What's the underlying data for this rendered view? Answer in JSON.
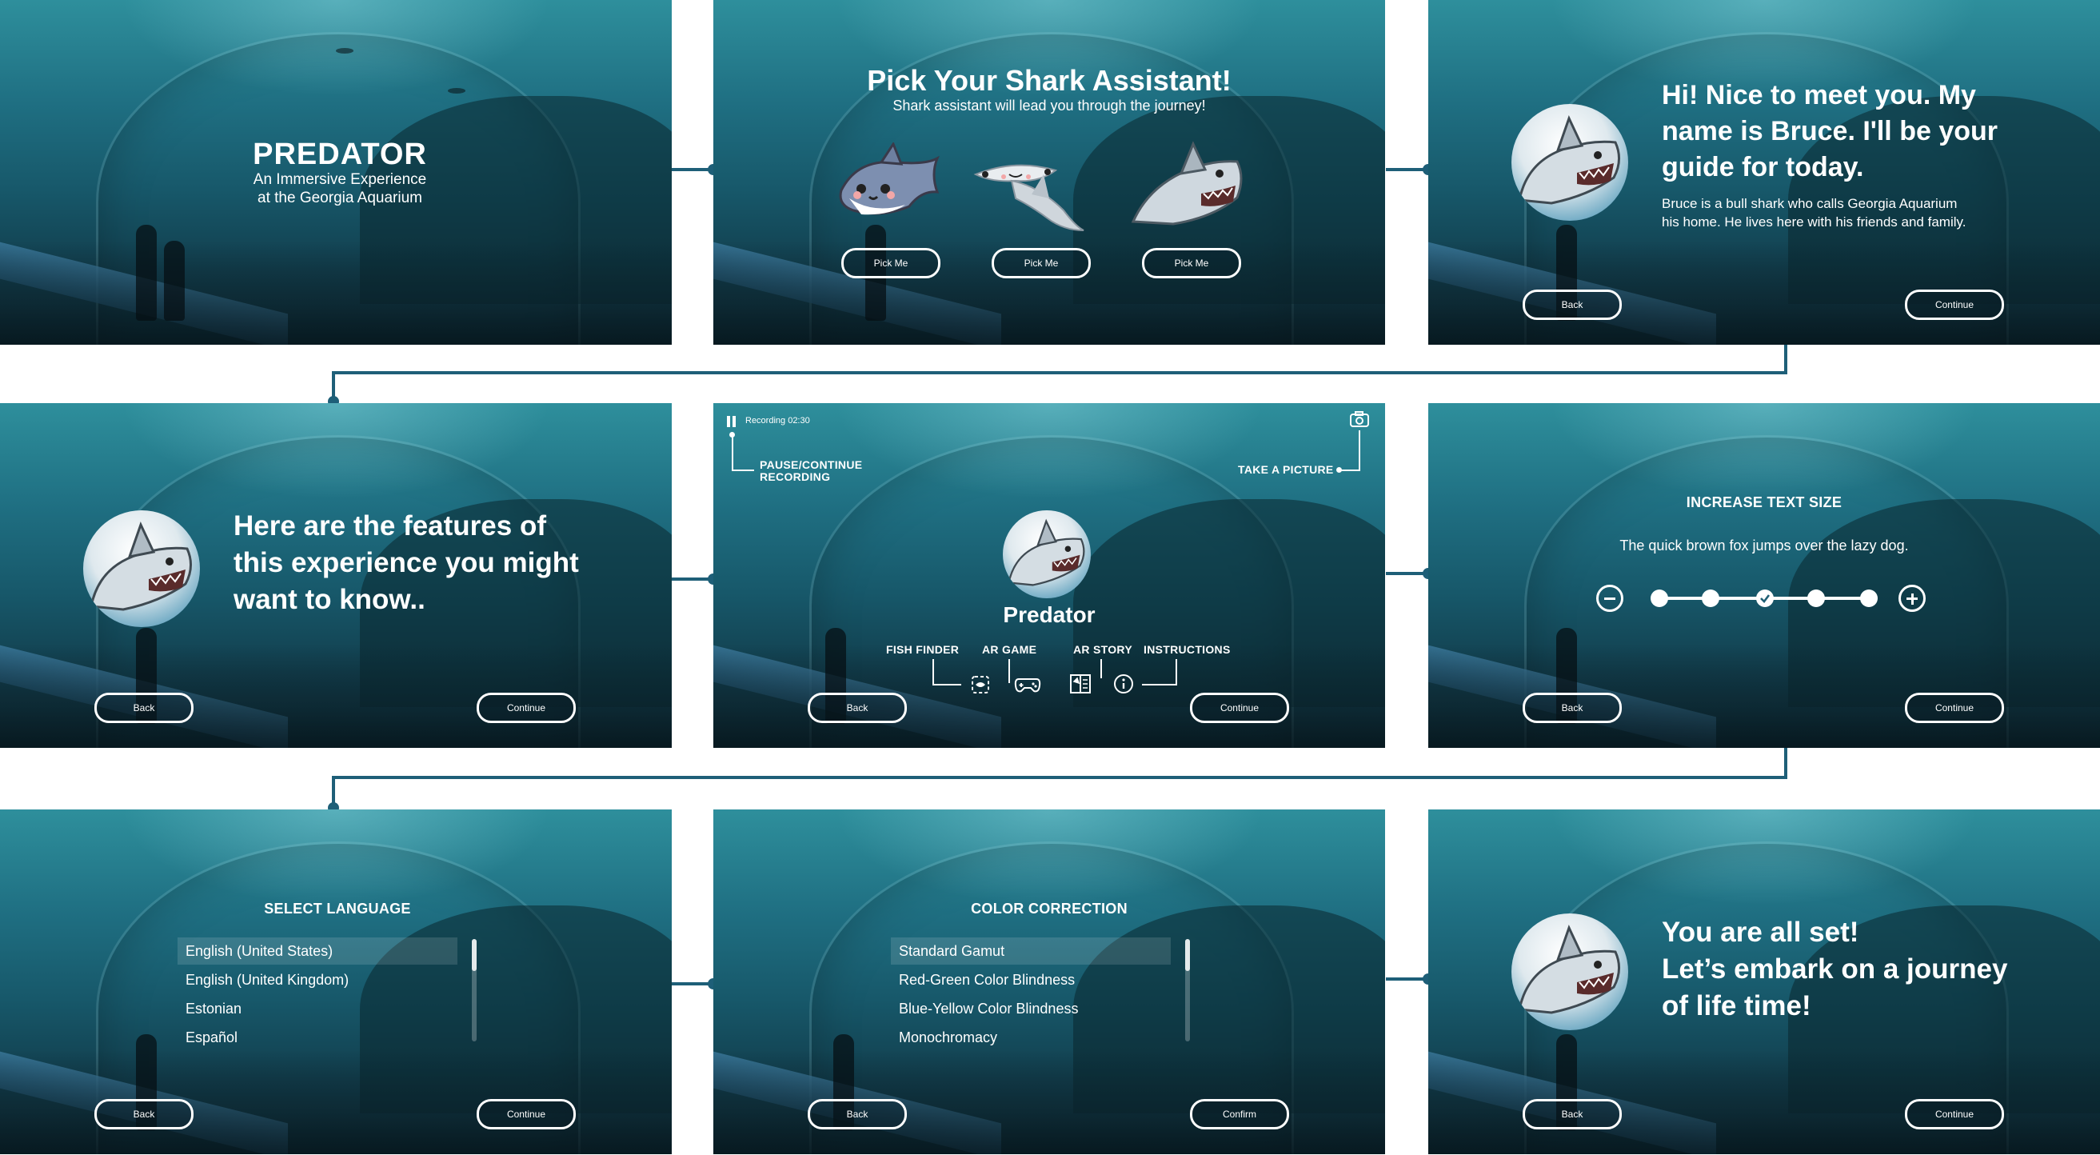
{
  "panel1": {
    "title": "PREDATOR",
    "subtitle_line1": "An Immersive Experience",
    "subtitle_line2": "at the Georgia Aquarium"
  },
  "panel2": {
    "title": "Pick Your Shark Assistant!",
    "subtitle": "Shark assistant will lead you through the journey!",
    "pick_labels": [
      "Pick Me",
      "Pick Me",
      "Pick Me"
    ]
  },
  "panel3": {
    "heading_line1": "Hi! Nice to meet you. My",
    "heading_line2": "name is Bruce.  I'll be your",
    "heading_line3": "guide for today.",
    "body_line1": "Bruce is a bull shark who calls Georgia Aquarium",
    "body_line2": "his home. He lives here with his friends and family.",
    "back": "Back",
    "continue": "Continue"
  },
  "panel4": {
    "heading_line1": "Here are the features of",
    "heading_line2": "this experience you might",
    "heading_line3": "want to know..",
    "back": "Back",
    "continue": "Continue"
  },
  "panel5": {
    "recording": "Recording 02:30",
    "pause_label_line1": "PAUSE/CONTINUE",
    "pause_label_line2": "RECORDING",
    "take_picture": "TAKE A PICTURE",
    "title": "Predator",
    "features": [
      "FISH FINDER",
      "AR GAME",
      "AR STORY",
      "INSTRUCTIONS"
    ],
    "icons": [
      "fish-finder-icon",
      "gamepad-icon",
      "book-icon",
      "info-icon",
      "camera-icon",
      "pause-icon"
    ],
    "back": "Back",
    "continue": "Continue"
  },
  "panel6": {
    "title": "INCREASE TEXT SIZE",
    "sample": "The quick brown fox jumps over the lazy dog.",
    "slider_steps": 5,
    "slider_selected": 3,
    "back": "Back",
    "continue": "Continue"
  },
  "panel7": {
    "title": "SELECT LANGUAGE",
    "options": [
      "English (United States)",
      "English (United Kingdom)",
      "Estonian",
      "Español"
    ],
    "selected": "English (United States)",
    "back": "Back",
    "continue": "Continue"
  },
  "panel8": {
    "title": "COLOR CORRECTION",
    "options": [
      "Standard Gamut",
      "Red-Green Color Blindness",
      "Blue-Yellow Color Blindness",
      "Monochromacy"
    ],
    "selected": "Standard Gamut",
    "back": "Back",
    "confirm": "Confirm"
  },
  "panel9": {
    "heading_line1": "You are all set!",
    "heading_line2": "Let’s embark on a journey",
    "heading_line3": "of life time!",
    "back": "Back",
    "continue": "Continue"
  },
  "colors": {
    "connector": "#1e5f78",
    "water_top": "#2e8f9c",
    "water_bottom": "#0e2f3a"
  }
}
